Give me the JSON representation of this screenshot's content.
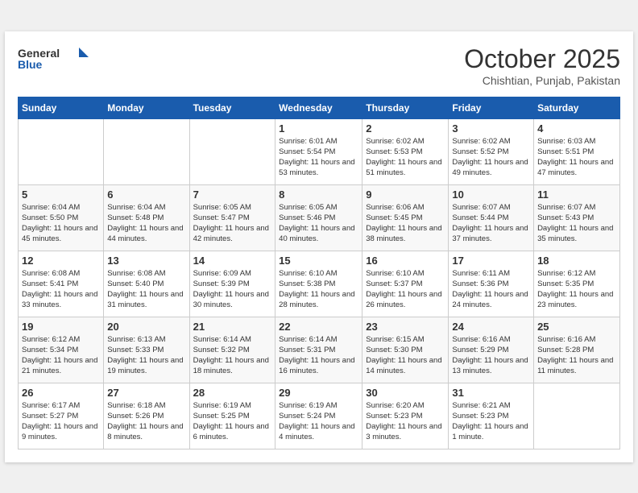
{
  "header": {
    "logo_general": "General",
    "logo_blue": "Blue",
    "month_title": "October 2025",
    "location": "Chishtian, Punjab, Pakistan"
  },
  "days_of_week": [
    "Sunday",
    "Monday",
    "Tuesday",
    "Wednesday",
    "Thursday",
    "Friday",
    "Saturday"
  ],
  "weeks": [
    [
      {
        "day": null,
        "info": null
      },
      {
        "day": null,
        "info": null
      },
      {
        "day": null,
        "info": null
      },
      {
        "day": "1",
        "info": "Sunrise: 6:01 AM\nSunset: 5:54 PM\nDaylight: 11 hours and 53 minutes."
      },
      {
        "day": "2",
        "info": "Sunrise: 6:02 AM\nSunset: 5:53 PM\nDaylight: 11 hours and 51 minutes."
      },
      {
        "day": "3",
        "info": "Sunrise: 6:02 AM\nSunset: 5:52 PM\nDaylight: 11 hours and 49 minutes."
      },
      {
        "day": "4",
        "info": "Sunrise: 6:03 AM\nSunset: 5:51 PM\nDaylight: 11 hours and 47 minutes."
      }
    ],
    [
      {
        "day": "5",
        "info": "Sunrise: 6:04 AM\nSunset: 5:50 PM\nDaylight: 11 hours and 45 minutes."
      },
      {
        "day": "6",
        "info": "Sunrise: 6:04 AM\nSunset: 5:48 PM\nDaylight: 11 hours and 44 minutes."
      },
      {
        "day": "7",
        "info": "Sunrise: 6:05 AM\nSunset: 5:47 PM\nDaylight: 11 hours and 42 minutes."
      },
      {
        "day": "8",
        "info": "Sunrise: 6:05 AM\nSunset: 5:46 PM\nDaylight: 11 hours and 40 minutes."
      },
      {
        "day": "9",
        "info": "Sunrise: 6:06 AM\nSunset: 5:45 PM\nDaylight: 11 hours and 38 minutes."
      },
      {
        "day": "10",
        "info": "Sunrise: 6:07 AM\nSunset: 5:44 PM\nDaylight: 11 hours and 37 minutes."
      },
      {
        "day": "11",
        "info": "Sunrise: 6:07 AM\nSunset: 5:43 PM\nDaylight: 11 hours and 35 minutes."
      }
    ],
    [
      {
        "day": "12",
        "info": "Sunrise: 6:08 AM\nSunset: 5:41 PM\nDaylight: 11 hours and 33 minutes."
      },
      {
        "day": "13",
        "info": "Sunrise: 6:08 AM\nSunset: 5:40 PM\nDaylight: 11 hours and 31 minutes."
      },
      {
        "day": "14",
        "info": "Sunrise: 6:09 AM\nSunset: 5:39 PM\nDaylight: 11 hours and 30 minutes."
      },
      {
        "day": "15",
        "info": "Sunrise: 6:10 AM\nSunset: 5:38 PM\nDaylight: 11 hours and 28 minutes."
      },
      {
        "day": "16",
        "info": "Sunrise: 6:10 AM\nSunset: 5:37 PM\nDaylight: 11 hours and 26 minutes."
      },
      {
        "day": "17",
        "info": "Sunrise: 6:11 AM\nSunset: 5:36 PM\nDaylight: 11 hours and 24 minutes."
      },
      {
        "day": "18",
        "info": "Sunrise: 6:12 AM\nSunset: 5:35 PM\nDaylight: 11 hours and 23 minutes."
      }
    ],
    [
      {
        "day": "19",
        "info": "Sunrise: 6:12 AM\nSunset: 5:34 PM\nDaylight: 11 hours and 21 minutes."
      },
      {
        "day": "20",
        "info": "Sunrise: 6:13 AM\nSunset: 5:33 PM\nDaylight: 11 hours and 19 minutes."
      },
      {
        "day": "21",
        "info": "Sunrise: 6:14 AM\nSunset: 5:32 PM\nDaylight: 11 hours and 18 minutes."
      },
      {
        "day": "22",
        "info": "Sunrise: 6:14 AM\nSunset: 5:31 PM\nDaylight: 11 hours and 16 minutes."
      },
      {
        "day": "23",
        "info": "Sunrise: 6:15 AM\nSunset: 5:30 PM\nDaylight: 11 hours and 14 minutes."
      },
      {
        "day": "24",
        "info": "Sunrise: 6:16 AM\nSunset: 5:29 PM\nDaylight: 11 hours and 13 minutes."
      },
      {
        "day": "25",
        "info": "Sunrise: 6:16 AM\nSunset: 5:28 PM\nDaylight: 11 hours and 11 minutes."
      }
    ],
    [
      {
        "day": "26",
        "info": "Sunrise: 6:17 AM\nSunset: 5:27 PM\nDaylight: 11 hours and 9 minutes."
      },
      {
        "day": "27",
        "info": "Sunrise: 6:18 AM\nSunset: 5:26 PM\nDaylight: 11 hours and 8 minutes."
      },
      {
        "day": "28",
        "info": "Sunrise: 6:19 AM\nSunset: 5:25 PM\nDaylight: 11 hours and 6 minutes."
      },
      {
        "day": "29",
        "info": "Sunrise: 6:19 AM\nSunset: 5:24 PM\nDaylight: 11 hours and 4 minutes."
      },
      {
        "day": "30",
        "info": "Sunrise: 6:20 AM\nSunset: 5:23 PM\nDaylight: 11 hours and 3 minutes."
      },
      {
        "day": "31",
        "info": "Sunrise: 6:21 AM\nSunset: 5:23 PM\nDaylight: 11 hours and 1 minute."
      },
      {
        "day": null,
        "info": null
      }
    ]
  ]
}
